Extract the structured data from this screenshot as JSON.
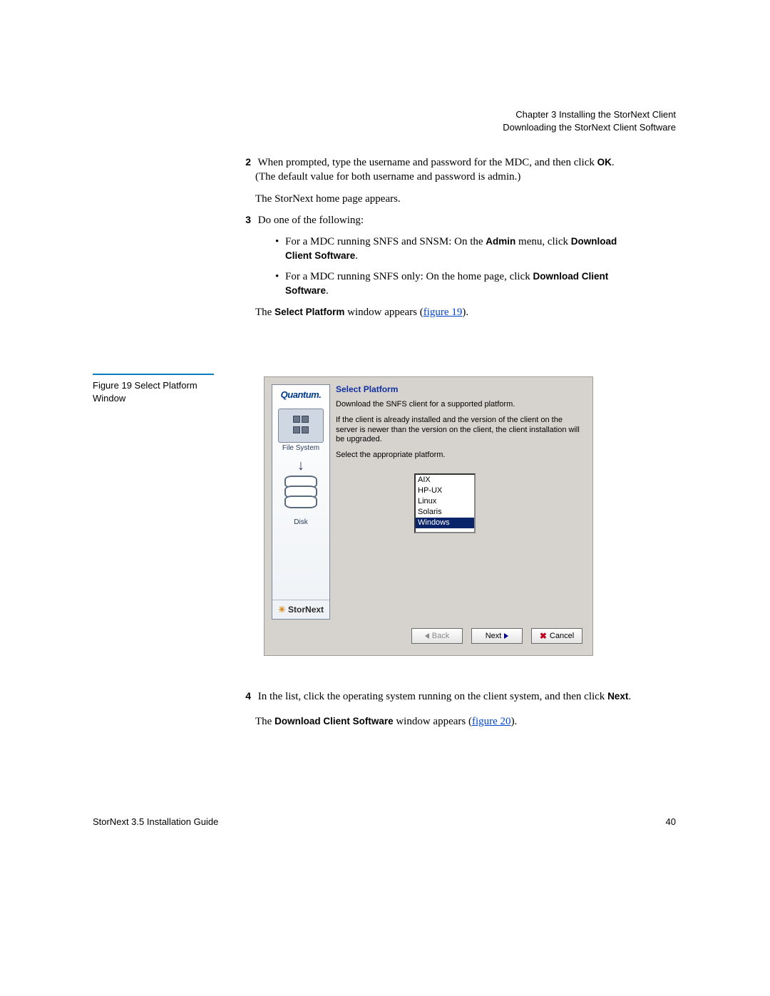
{
  "header": {
    "chapter": "Chapter 3  Installing the StorNext Client",
    "section": "Downloading the StorNext Client Software"
  },
  "steps": {
    "s2_num": "2",
    "s2_a": "When prompted, type the username and password for the MDC, and then click ",
    "s2_ok": "OK",
    "s2_b": ". (The default value for both username and password is admin.)",
    "s2_after": "The StorNext home page appears.",
    "s3_num": "3",
    "s3_text": "Do one of the following:",
    "s3_b1_a": "For a MDC running SNFS and SNSM: On the ",
    "s3_b1_admin": "Admin",
    "s3_b1_b": " menu, click ",
    "s3_b1_dl": "Download Client Software",
    "s3_b2_a": "For a MDC running SNFS only: On the home page, click ",
    "s3_b2_dl": "Download Client Software",
    "s3_after_a": "The ",
    "s3_after_bold": "Select Platform",
    "s3_after_b": " window appears (",
    "s3_after_link": "figure 19",
    "s3_after_c": ").",
    "s4_num": "4",
    "s4_a": "In the list, click the operating system running on the client system, and then click ",
    "s4_next": "Next",
    "s4_after_a": "The ",
    "s4_after_bold": "Download Client Software",
    "s4_after_b": " window appears (",
    "s4_after_link": "figure 20",
    "s4_after_c": ")."
  },
  "figure": {
    "caption_a": "Figure 19  Select Platform",
    "caption_b": "Window"
  },
  "dialog": {
    "brand": "Quantum.",
    "tile1": "File System",
    "disk_label": "Disk",
    "logo": "StorNext",
    "title": "Select Platform",
    "p1": "Download the SNFS client for a supported platform.",
    "p2": "If the client is already installed and the version of the client on the server is newer than the version on the client, the client installation will be upgraded.",
    "p3": "Select the appropriate platform.",
    "options": [
      "AIX",
      "HP-UX",
      "Linux",
      "Solaris",
      "Windows"
    ],
    "selected_index": 4,
    "btn_back": "Back",
    "btn_next": "Next",
    "btn_cancel": "Cancel"
  },
  "footer": {
    "left": "StorNext 3.5 Installation Guide",
    "page": "40"
  }
}
